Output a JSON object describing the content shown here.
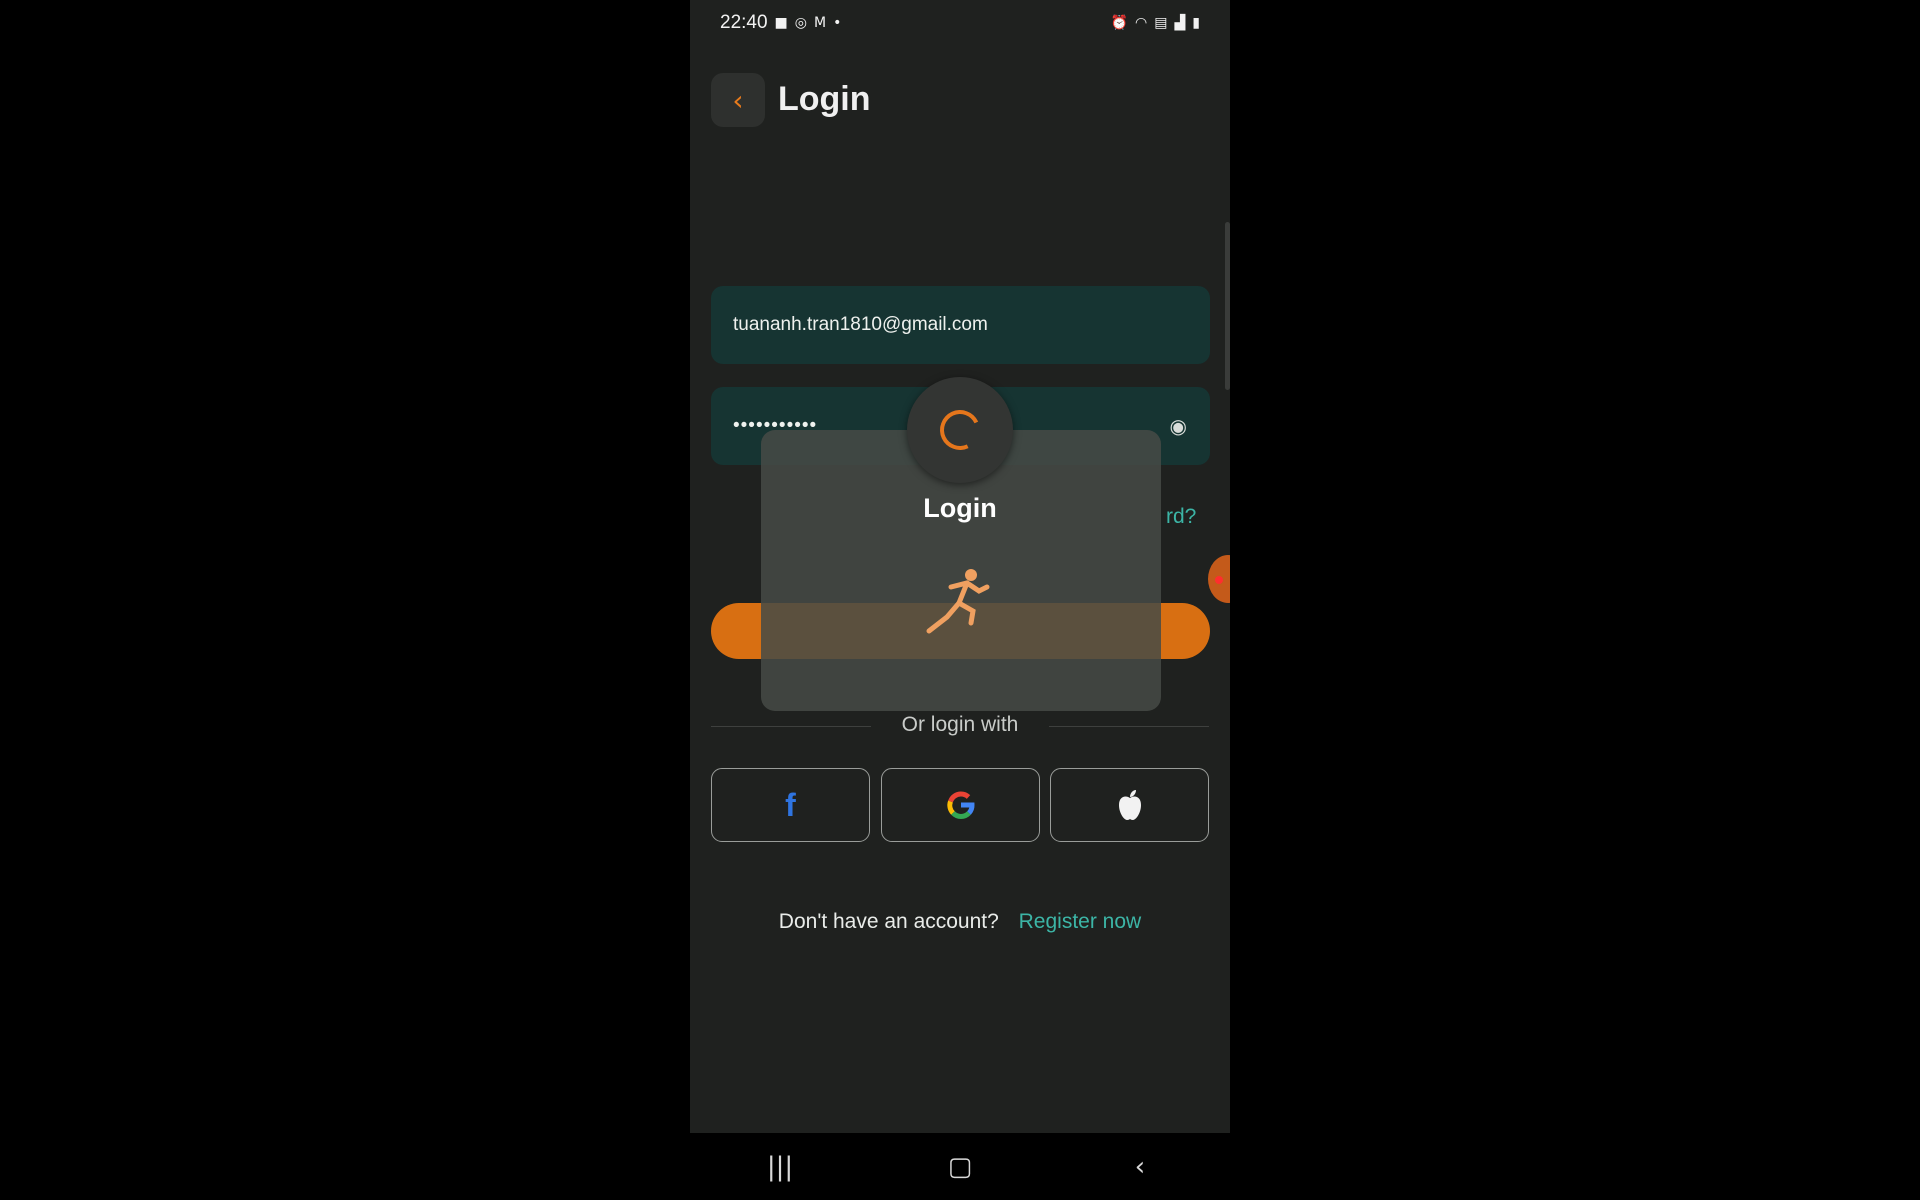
{
  "status_bar": {
    "time": "22:40",
    "left_icons": [
      "video-icon",
      "vpn-icon",
      "gmail-icon",
      "dot-icon"
    ],
    "right_icons": [
      "alarm-icon",
      "wifi-icon",
      "lte-icon",
      "signal-icon",
      "battery-icon"
    ]
  },
  "header": {
    "title": "Login",
    "back_icon": "chevron-left-icon"
  },
  "form": {
    "email_value": "tuananh.tran1810@gmail.com",
    "password_value": "•••••••••••",
    "eye_icon": "eye-icon",
    "forgot_visible": "rd?"
  },
  "divider_text": "Or login with",
  "social": {
    "facebook_icon": "facebook-icon",
    "google_icon": "google-icon",
    "apple_icon": "apple-icon"
  },
  "footer": {
    "prompt": "Don't have an account?",
    "register_link": "Register now"
  },
  "loading_overlay": {
    "title": "Login",
    "spinner_icon": "spinner-icon",
    "runner_icon": "runner-icon"
  },
  "nav_bar": {
    "recents_icon": "recents-icon",
    "home_icon": "home-icon",
    "back_icon": "back-icon"
  },
  "colors": {
    "accent": "#e5761c",
    "teal": "#3cb5a6",
    "field_bg": "#163432",
    "screen_bg": "#1f211f"
  }
}
